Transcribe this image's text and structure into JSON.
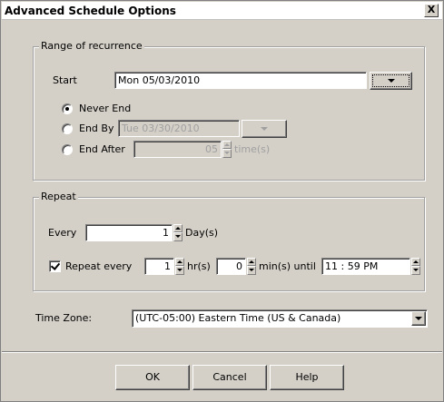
{
  "window": {
    "title": "Advanced Schedule Options",
    "close_label": "X"
  },
  "range": {
    "legend": "Range of recurrence",
    "start_label": "Start",
    "start_value": "Mon 05/03/2010",
    "never_end_label": "Never End",
    "end_by_label": "End By",
    "end_by_value": "Tue 03/30/2010",
    "end_after_label": "End After",
    "end_after_value": "05",
    "end_after_unit": "time(s)"
  },
  "repeat": {
    "legend": "Repeat",
    "every_label": "Every",
    "every_value": "1",
    "every_unit": "Day(s)",
    "repeat_every_label": "Repeat every",
    "hours_value": "1",
    "hours_unit": "hr(s)",
    "mins_value": "0",
    "mins_unit": "min(s) until",
    "until_value": "11 : 59 PM"
  },
  "timezone": {
    "label": "Time Zone:",
    "value": "(UTC-05:00) Eastern Time (US & Canada)"
  },
  "buttons": {
    "ok": "OK",
    "cancel": "Cancel",
    "help": "Help"
  },
  "state": {
    "range_option_selected": "never_end",
    "repeat_every_checked": true
  }
}
